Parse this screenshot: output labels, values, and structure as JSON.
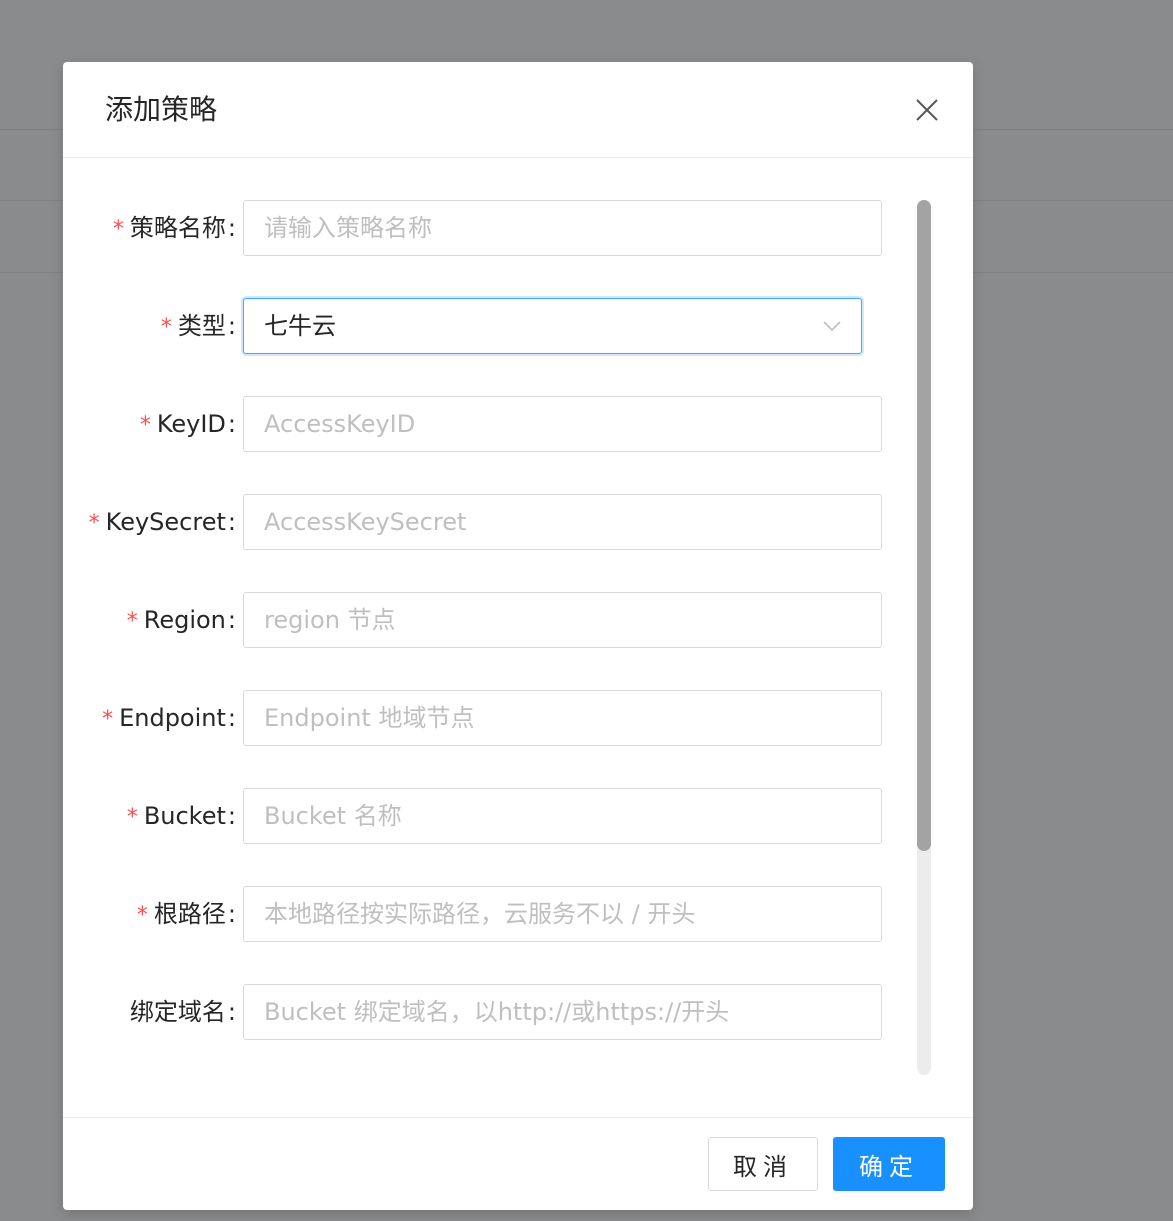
{
  "modal": {
    "title": "添加策略",
    "fields": [
      {
        "label": "策略名称",
        "required": true,
        "type": "input",
        "value": "",
        "placeholder": "请输入策略名称"
      },
      {
        "label": "类型",
        "required": true,
        "type": "select",
        "value": "七牛云",
        "placeholder": ""
      },
      {
        "label": "KeyID",
        "required": true,
        "type": "input",
        "value": "",
        "placeholder": "AccessKeyID"
      },
      {
        "label": "KeySecret",
        "required": true,
        "type": "input",
        "value": "",
        "placeholder": "AccessKeySecret"
      },
      {
        "label": "Region",
        "required": true,
        "type": "input",
        "value": "",
        "placeholder": "region 节点"
      },
      {
        "label": "Endpoint",
        "required": true,
        "type": "input",
        "value": "",
        "placeholder": "Endpoint 地域节点"
      },
      {
        "label": "Bucket",
        "required": true,
        "type": "input",
        "value": "",
        "placeholder": "Bucket 名称"
      },
      {
        "label": "根路径",
        "required": true,
        "type": "input",
        "value": "",
        "placeholder": "本地路径按实际路径，云服务不以 / 开头"
      },
      {
        "label": "绑定域名",
        "required": false,
        "type": "input",
        "value": "",
        "placeholder": "Bucket 绑定域名，以http://或https://开头"
      }
    ],
    "required_mark": "*",
    "colon": ":",
    "footer": {
      "cancel_label": "取消",
      "ok_label": "确定"
    }
  },
  "icons": {
    "close": "close-icon",
    "select_arrow": "chevron-down-icon"
  },
  "colors": {
    "primary": "#1890ff",
    "required": "#ff4d4f",
    "placeholder": "#bfbfbf",
    "overlay": "#8a8b8c"
  }
}
